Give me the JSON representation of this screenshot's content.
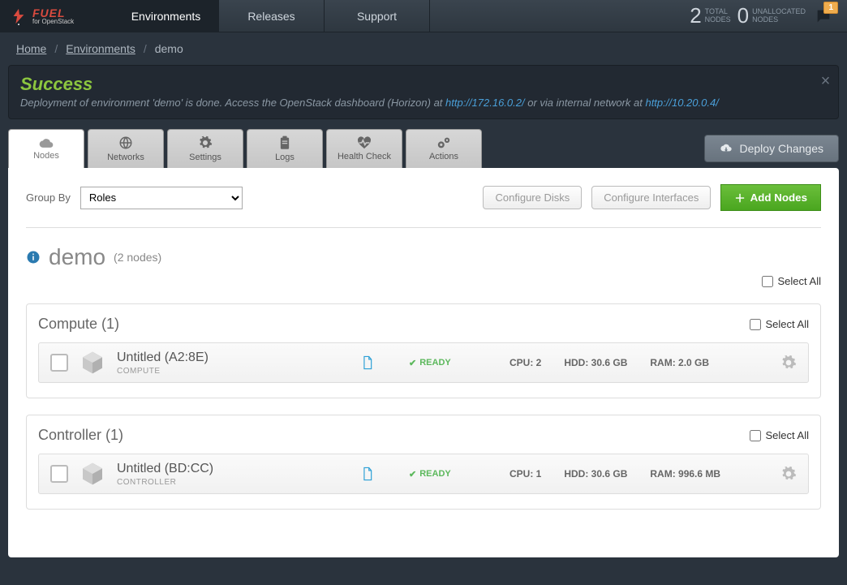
{
  "brand": {
    "name": "FUEL",
    "subtitle": "for OpenStack"
  },
  "nav": {
    "environments": "Environments",
    "releases": "Releases",
    "support": "Support"
  },
  "topstats": {
    "total_num": "2",
    "total_label": "TOTAL\nNODES",
    "unalloc_num": "0",
    "unalloc_label": "UNALLOCATED\nNODES",
    "notif_count": "1"
  },
  "breadcrumb": {
    "home": "Home",
    "environments": "Environments",
    "current": "demo"
  },
  "alert": {
    "title": "Success",
    "body_pre": "Deployment of environment 'demo' is done. Access the OpenStack dashboard (Horizon) at ",
    "link1": "http://172.16.0.2/",
    "body_mid": " or via internal network at ",
    "link2": "http://10.20.0.4/"
  },
  "tabs": {
    "nodes": "Nodes",
    "networks": "Networks",
    "settings": "Settings",
    "logs": "Logs",
    "health": "Health Check",
    "actions": "Actions"
  },
  "deploy": "Deploy Changes",
  "toolbar": {
    "groupby_label": "Group By",
    "groupby_value": "Roles",
    "configure_disks": "Configure Disks",
    "configure_interfaces": "Configure Interfaces",
    "add_nodes": "Add Nodes"
  },
  "env": {
    "name": "demo",
    "count": "(2 nodes)"
  },
  "select_all": "Select All",
  "groups": [
    {
      "title": "Compute (1)",
      "node": {
        "name": "Untitled (A2:8E)",
        "role": "COMPUTE",
        "status": "READY",
        "cpu": "CPU: 2",
        "hdd": "HDD: 30.6 GB",
        "ram": "RAM: 2.0 GB"
      }
    },
    {
      "title": "Controller (1)",
      "node": {
        "name": "Untitled (BD:CC)",
        "role": "CONTROLLER",
        "status": "READY",
        "cpu": "CPU: 1",
        "hdd": "HDD: 30.6 GB",
        "ram": "RAM: 996.6 MB"
      }
    }
  ]
}
